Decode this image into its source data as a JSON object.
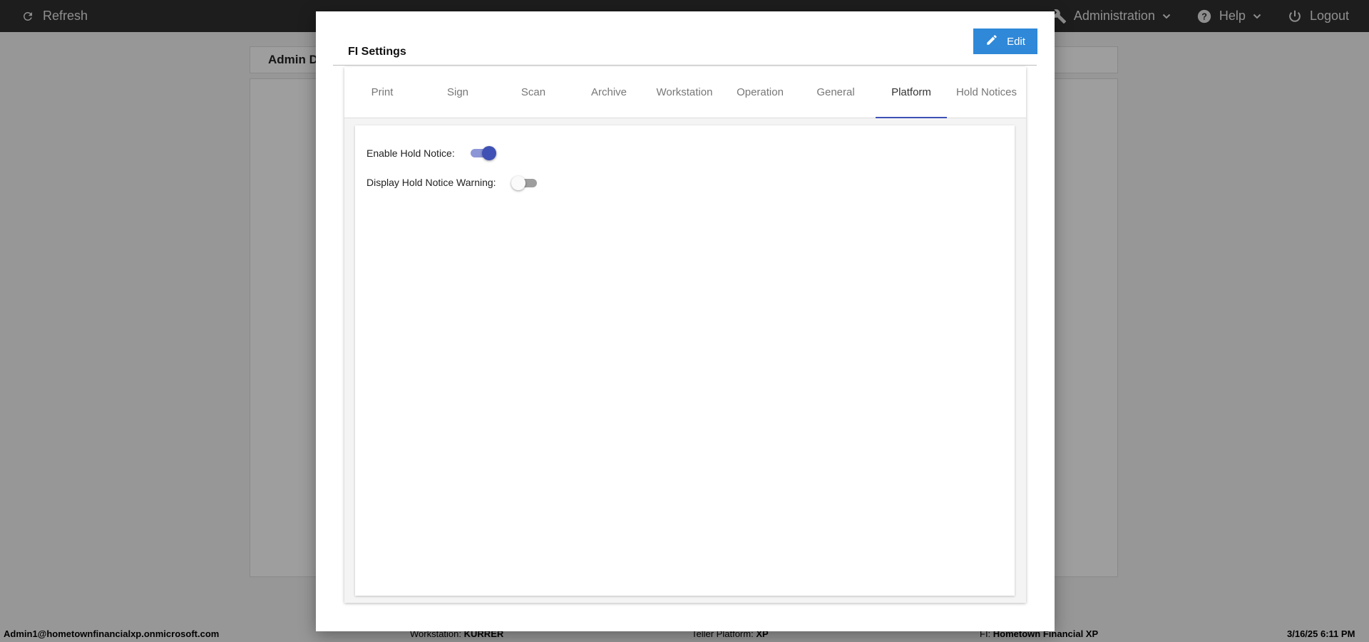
{
  "topbar": {
    "refresh_label": "Refresh",
    "administration_label": "Administration",
    "help_label": "Help",
    "logout_label": "Logout"
  },
  "background": {
    "panel_title": "Admin D"
  },
  "statusbar": {
    "user": "Admin1@hometownfinancialxp.onmicrosoft.com",
    "workstation_label": "Workstation:",
    "workstation_value": "KURRER",
    "teller_label": "Teller Platform:",
    "teller_value": "XP",
    "fi_label": "FI:",
    "fi_value": "Hometown Financial XP",
    "datetime": "3/16/25 6:11 PM"
  },
  "modal": {
    "title": "FI Settings",
    "edit_label": "Edit",
    "tabs": [
      {
        "label": "Print"
      },
      {
        "label": "Sign"
      },
      {
        "label": "Scan"
      },
      {
        "label": "Archive"
      },
      {
        "label": "Workstation"
      },
      {
        "label": "Operation"
      },
      {
        "label": "General"
      },
      {
        "label": "Platform",
        "active": true
      },
      {
        "label": "Hold Notices"
      }
    ],
    "settings": [
      {
        "label": "Enable Hold Notice:",
        "enabled": true
      },
      {
        "label": "Display Hold Notice Warning:",
        "enabled": false
      }
    ]
  },
  "colors": {
    "accent": "#3f51b5",
    "edit_button": "#2f88d8",
    "topbar": "#2f2f2f"
  }
}
